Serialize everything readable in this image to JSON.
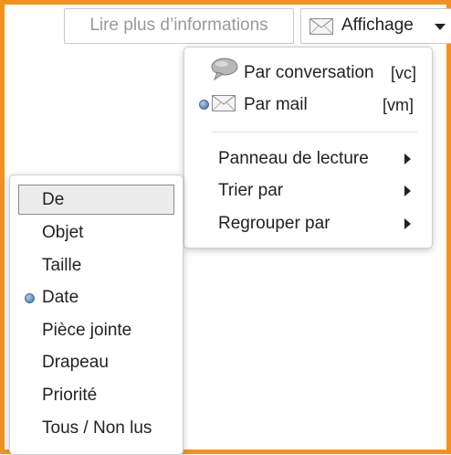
{
  "toolbar": {
    "more_info_label": "Lire plus d’informations",
    "view_label": "Affichage"
  },
  "view_menu": {
    "items": [
      {
        "label": "Par conversation",
        "shortcut": "[vc]",
        "icon": "speech-bubble-icon",
        "checked": false
      },
      {
        "label": "Par mail",
        "shortcut": "[vm]",
        "icon": "envelope-icon",
        "checked": true
      }
    ],
    "submenus": [
      {
        "label": "Panneau de lecture"
      },
      {
        "label": "Trier par"
      },
      {
        "label": "Regrouper par"
      }
    ]
  },
  "sort_menu": {
    "items": [
      {
        "label": "De",
        "highlighted": true,
        "checked": false
      },
      {
        "label": "Objet",
        "checked": false
      },
      {
        "label": "Taille",
        "checked": false
      },
      {
        "label": "Date",
        "checked": true
      },
      {
        "label": "Pièce jointe",
        "checked": false
      },
      {
        "label": "Drapeau",
        "checked": false
      },
      {
        "label": "Priorité",
        "checked": false
      },
      {
        "label": "Tous / Non lus",
        "checked": false
      }
    ]
  },
  "colors": {
    "frame_border": "#F5901E",
    "radio_dot": "#5c85b3"
  }
}
